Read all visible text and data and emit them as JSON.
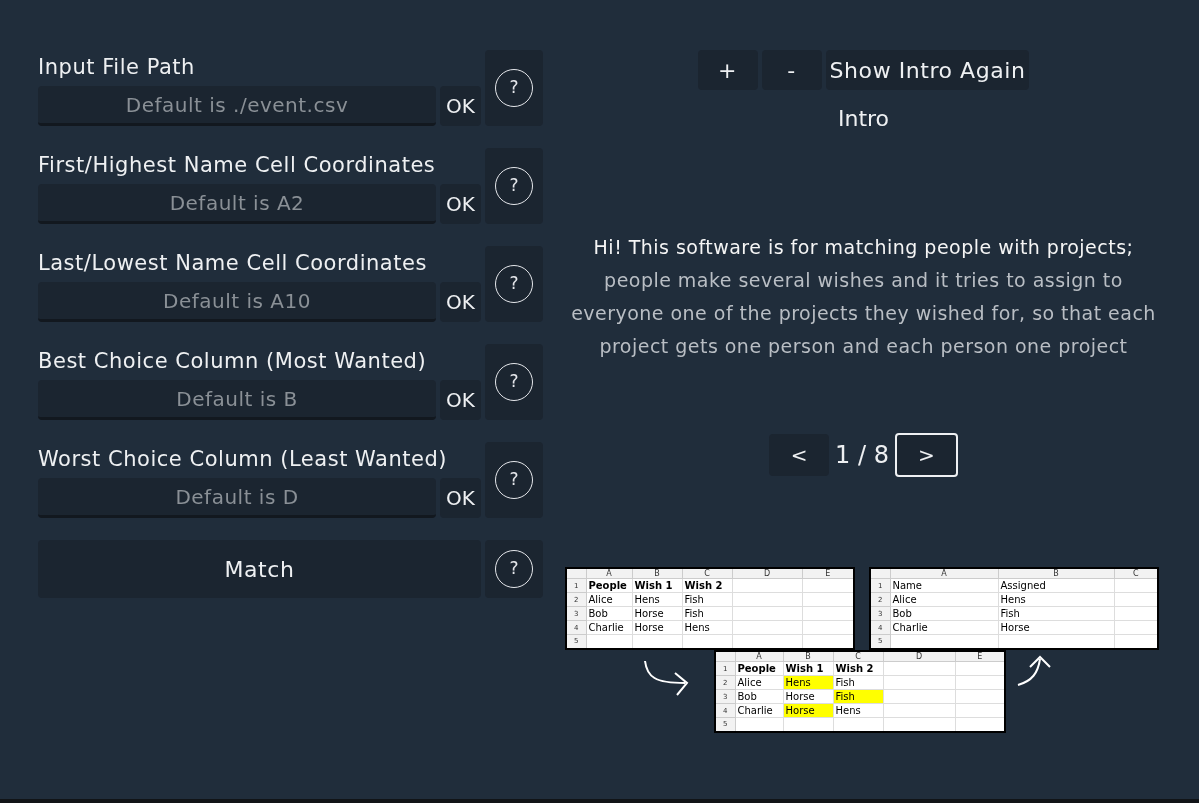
{
  "fields": [
    {
      "label": "Input File Path",
      "placeholder": "Default is ./event.csv",
      "ok": "OK",
      "help": "?"
    },
    {
      "label": "First/Highest Name Cell Coordinates",
      "placeholder": "Default is A2",
      "ok": "OK",
      "help": "?"
    },
    {
      "label": "Last/Lowest Name Cell Coordinates",
      "placeholder": "Default is A10",
      "ok": "OK",
      "help": "?"
    },
    {
      "label": "Best Choice Column (Most Wanted)",
      "placeholder": "Default is B",
      "ok": "OK",
      "help": "?"
    },
    {
      "label": "Worst Choice Column (Least Wanted)",
      "placeholder": "Default is D",
      "ok": "OK",
      "help": "?"
    }
  ],
  "match": {
    "label": "Match",
    "help": "?"
  },
  "toolbar": {
    "zoom_in": "+",
    "zoom_out": "-",
    "show_intro": "Show Intro Again"
  },
  "intro": {
    "title": "Intro",
    "lead": "Hi! This software is for matching people with projects;",
    "body": " people make several wishes and it tries to assign to everyone one of the projects they wished for, so that each project gets one person and each person one project"
  },
  "pager": {
    "prev": "<",
    "page": "1 / 8",
    "next": ">"
  },
  "sheets": [
    {
      "columns": [
        "A",
        "B",
        "C",
        "D",
        "E"
      ],
      "rows": [
        {
          "number": "1",
          "bold": true,
          "cells": [
            {
              "text": "People",
              "highlighted": false
            },
            {
              "text": "Wish 1",
              "highlighted": false
            },
            {
              "text": "Wish 2",
              "highlighted": false
            }
          ]
        },
        {
          "number": "2",
          "bold": false,
          "cells": [
            {
              "text": "Alice",
              "highlighted": false
            },
            {
              "text": "Hens",
              "highlighted": false
            },
            {
              "text": "Fish",
              "highlighted": false
            }
          ]
        },
        {
          "number": "3",
          "bold": false,
          "cells": [
            {
              "text": "Bob",
              "highlighted": false
            },
            {
              "text": "Horse",
              "highlighted": false
            },
            {
              "text": "Fish",
              "highlighted": false
            }
          ]
        },
        {
          "number": "4",
          "bold": false,
          "cells": [
            {
              "text": "Charlie",
              "highlighted": false
            },
            {
              "text": "Horse",
              "highlighted": false
            },
            {
              "text": "Hens",
              "highlighted": false
            }
          ]
        },
        {
          "number": "5",
          "cells": []
        }
      ]
    },
    {
      "columns": [
        "A",
        "B",
        "C"
      ],
      "rows": [
        {
          "number": "1",
          "bold": false,
          "cells": [
            {
              "text": "Name",
              "highlighted": false
            },
            {
              "text": "Assigned",
              "highlighted": false
            }
          ]
        },
        {
          "number": "2",
          "bold": false,
          "cells": [
            {
              "text": "Alice",
              "highlighted": false
            },
            {
              "text": "Hens",
              "highlighted": false
            }
          ]
        },
        {
          "number": "3",
          "bold": false,
          "cells": [
            {
              "text": "Bob",
              "highlighted": false
            },
            {
              "text": "Fish",
              "highlighted": false
            }
          ]
        },
        {
          "number": "4",
          "bold": false,
          "cells": [
            {
              "text": "Charlie",
              "highlighted": false
            },
            {
              "text": "Horse",
              "highlighted": false
            }
          ]
        },
        {
          "number": "5",
          "cells": []
        }
      ]
    },
    {
      "columns": [
        "A",
        "B",
        "C",
        "D",
        "E"
      ],
      "rows": [
        {
          "number": "1",
          "bold": true,
          "cells": [
            {
              "text": "People",
              "highlighted": false
            },
            {
              "text": "Wish 1",
              "highlighted": false
            },
            {
              "text": "Wish 2",
              "highlighted": false
            }
          ]
        },
        {
          "number": "2",
          "bold": false,
          "cells": [
            {
              "text": "Alice",
              "highlighted": false
            },
            {
              "text": "Hens",
              "highlighted": true
            },
            {
              "text": "Fish",
              "highlighted": false
            }
          ]
        },
        {
          "number": "3",
          "bold": false,
          "cells": [
            {
              "text": "Bob",
              "highlighted": false
            },
            {
              "text": "Horse",
              "highlighted": false
            },
            {
              "text": "Fish",
              "highlighted": true
            }
          ]
        },
        {
          "number": "4",
          "bold": false,
          "cells": [
            {
              "text": "Charlie",
              "highlighted": false
            },
            {
              "text": "Horse",
              "highlighted": true
            },
            {
              "text": "Hens",
              "highlighted": false
            }
          ]
        },
        {
          "number": "5",
          "cells": []
        }
      ]
    }
  ]
}
